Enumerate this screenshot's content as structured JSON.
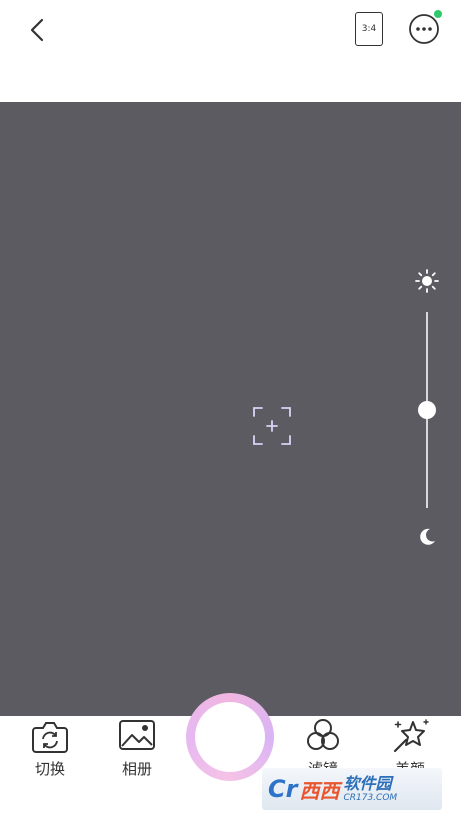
{
  "top_bar": {
    "aspect_ratio": "3:4",
    "notification_color": "#2ec96b"
  },
  "camera": {
    "exposure_level": 0.5
  },
  "tools": {
    "switch_label": "切换",
    "album_label": "相册",
    "filter_label": "滤镜",
    "beauty_label": "美颜"
  },
  "watermark": {
    "logo": "Cr",
    "brand": "西西",
    "text": "软件园",
    "url": "CR173.COM"
  },
  "colors": {
    "viewfinder": "#5b5b61",
    "shutter_gradient": [
      "#f1b6e0",
      "#d9b4f4"
    ]
  }
}
